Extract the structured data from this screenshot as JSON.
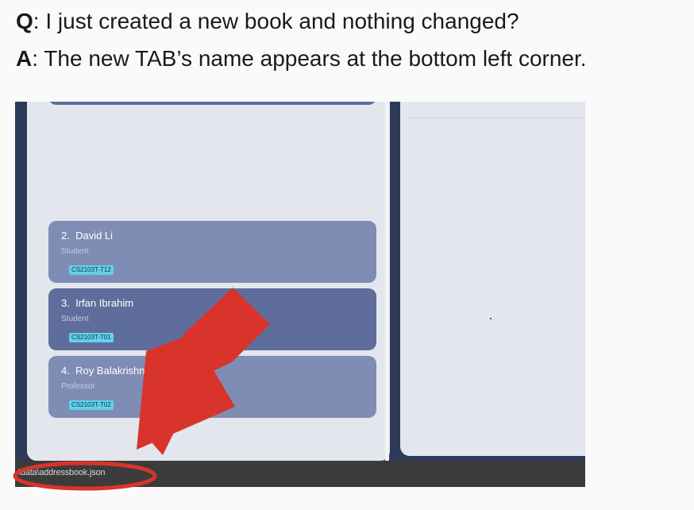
{
  "qa": {
    "q_label": "Q",
    "q_text": ": I just created a new book and nothing changed?",
    "a_label": "A",
    "a_text": ": The new TAB’s name appears at the bottom left corner."
  },
  "persons": [
    {
      "index": "2.",
      "name": "David Li",
      "role": "Student",
      "tag": "CS2103T-T12",
      "selected": false
    },
    {
      "index": "3.",
      "name": "Irfan Ibrahim",
      "role": "Student",
      "tag": "CS2103T-T01",
      "selected": true
    },
    {
      "index": "4.",
      "name": "Roy Balakrishnan",
      "role": "Professor",
      "tag": "CS2103T-T02",
      "selected": false
    }
  ],
  "status_bar": {
    "path": "\\data\\addressbook.json"
  },
  "colors": {
    "arrow": "#d9342b",
    "card": "#7f8db4",
    "card_selected": "#5f6d9c",
    "tag": "#5fd3ea"
  }
}
